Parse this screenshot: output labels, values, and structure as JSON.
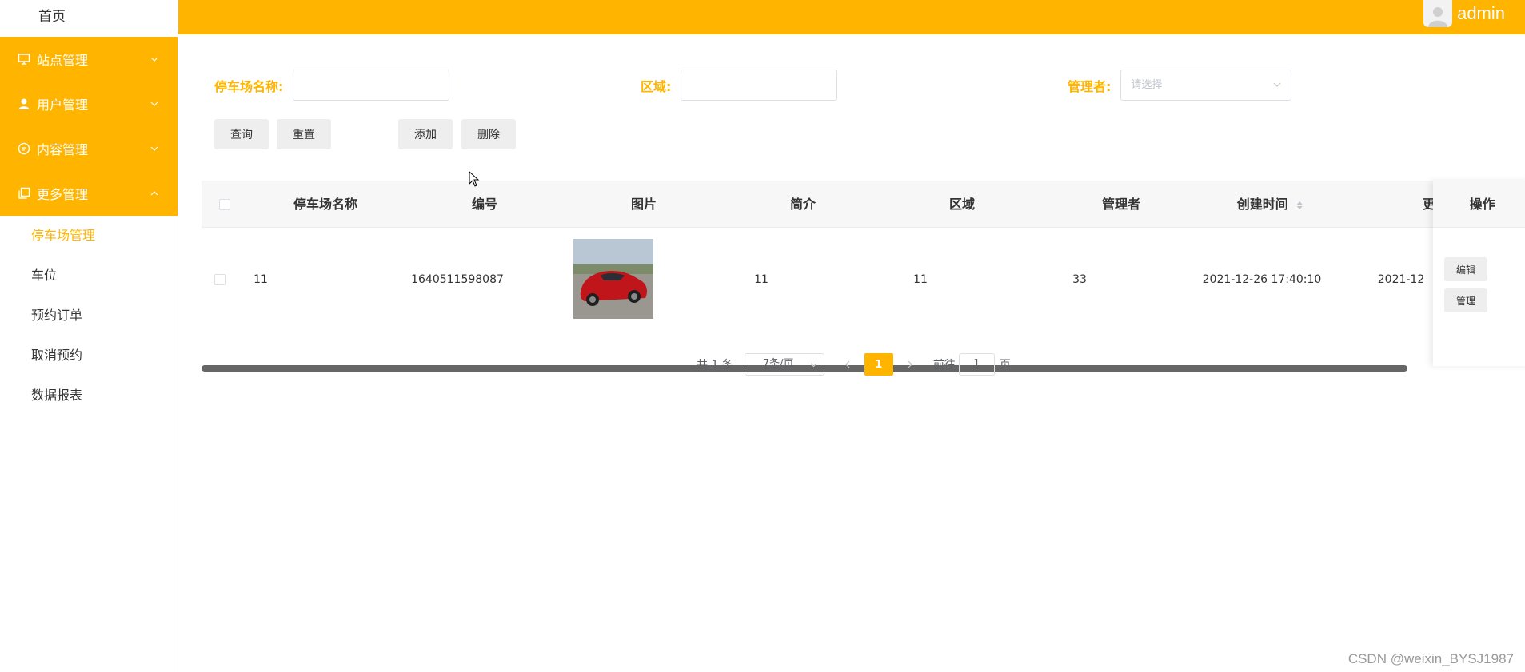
{
  "sidebar": {
    "home": "首页",
    "menus": [
      {
        "label": "站点管理",
        "icon": "monitor-icon"
      },
      {
        "label": "用户管理",
        "icon": "user-icon"
      },
      {
        "label": "内容管理",
        "icon": "chat-icon"
      },
      {
        "label": "更多管理",
        "icon": "copy-icon"
      }
    ],
    "submenu": [
      {
        "label": "停车场管理",
        "active": true
      },
      {
        "label": "车位"
      },
      {
        "label": "预约订单"
      },
      {
        "label": "取消预约"
      },
      {
        "label": "数据报表"
      }
    ]
  },
  "header": {
    "username": "admin",
    "accent_color": "#ffb400"
  },
  "search": {
    "name_label": "停车场名称:",
    "name_value": "",
    "area_label": "区域:",
    "area_value": "",
    "manager_label": "管理者:",
    "manager_placeholder": "请选择"
  },
  "buttons": {
    "query": "查询",
    "reset": "重置",
    "add": "添加",
    "delete": "删除"
  },
  "table": {
    "columns": [
      "停车场名称",
      "编号",
      "图片",
      "简介",
      "区域",
      "管理者",
      "创建时间",
      "更"
    ],
    "action_column": "操作",
    "rows": [
      {
        "name": "11",
        "code": "1640511598087",
        "image": "red-sports-car-photo",
        "intro": "11",
        "area": "11",
        "manager": "33",
        "created": "2021-12-26 17:40:10",
        "updated_partial": "2021-12",
        "edit_label": "编辑",
        "manage_label": "管理"
      }
    ]
  },
  "pagination": {
    "total": "共 1 条",
    "page_size": "7条/页",
    "current_page": "1",
    "goto_prefix": "前往",
    "goto_value": "1",
    "goto_suffix": "页"
  },
  "watermark": "CSDN @weixin_BYSJ1987"
}
